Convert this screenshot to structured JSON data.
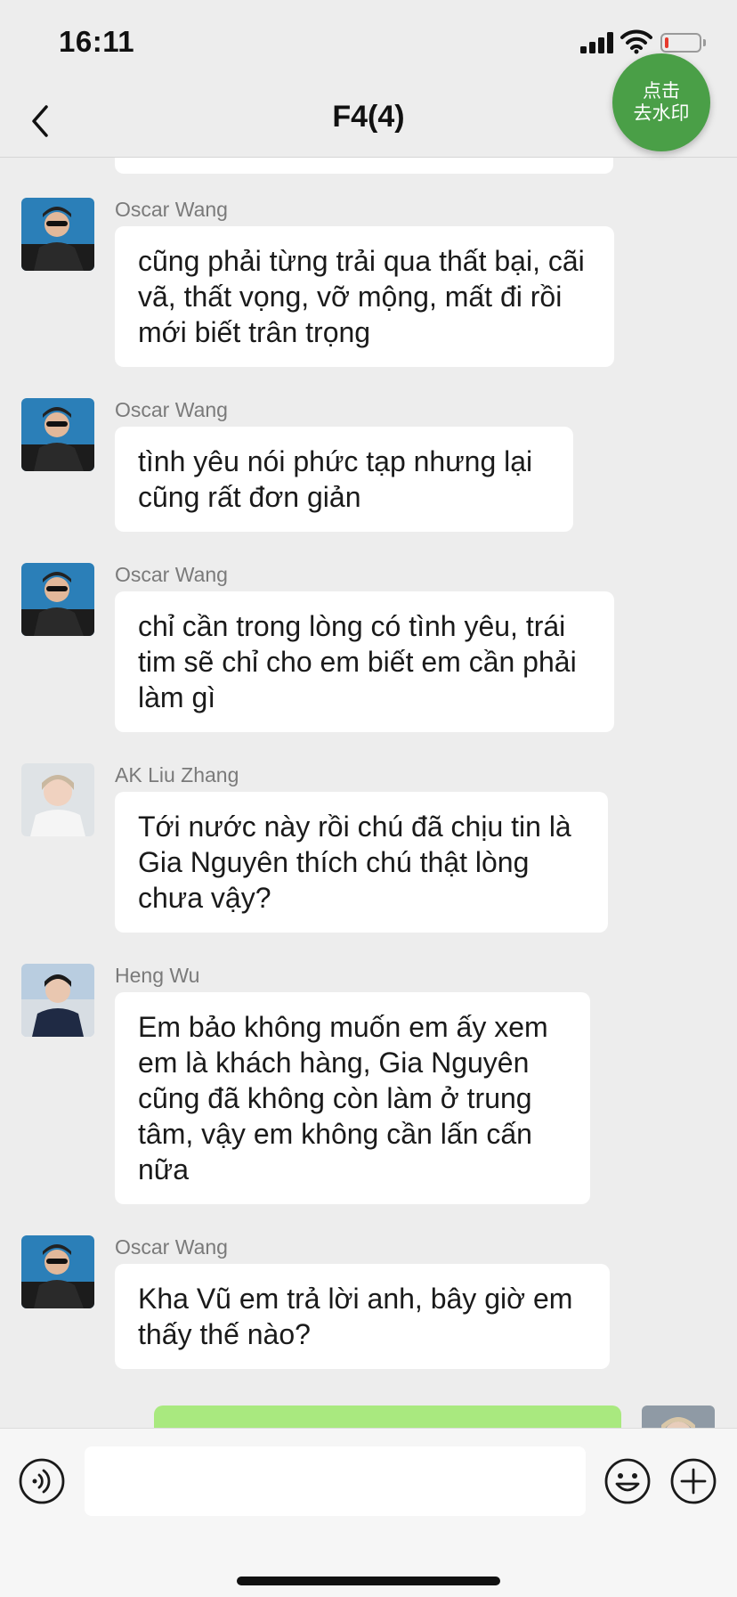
{
  "status_bar": {
    "time": "16:11"
  },
  "nav": {
    "title": "F4(4)",
    "back_icon": "chevron-left-icon"
  },
  "watermark_button": {
    "line1": "点击",
    "line2": "去水印"
  },
  "messages": [
    {
      "sender": "Oscar Wang",
      "text": "cũng phải từng trải qua thất bại, cãi vã, thất vọng, vỡ mộng, mất đi rồi mới biết trân trọng"
    },
    {
      "sender": "Oscar Wang",
      "text": "tình yêu nói phức tạp nhưng lại cũng rất đơn giản"
    },
    {
      "sender": "Oscar Wang",
      "text": "chỉ cần trong lòng có tình yêu, trái tim sẽ chỉ cho em biết em cần phải làm gì"
    },
    {
      "sender": "AK Liu Zhang",
      "text": "Tới nước này rồi chú đã chịu tin là Gia Nguyên thích chú thật lòng chưa vậy?"
    },
    {
      "sender": "Heng Wu",
      "text": "Em bảo không muốn em ấy xem em là khách hàng, Gia Nguyên cũng đã không còn làm ở trung tâm, vậy em không cần lấn cấn nữa"
    },
    {
      "sender": "Oscar Wang",
      "text": "Kha Vũ em trả lời anh, bây giờ em thấy thế nào?"
    }
  ],
  "colors": {
    "background": "#ededed",
    "bubble_in": "#ffffff",
    "bubble_out": "#a9e97f",
    "watermark_button": "#4a9f47"
  },
  "input_bar": {
    "voice_icon": "voice-icon",
    "emoji_icon": "emoji-icon",
    "plus_icon": "plus-icon",
    "placeholder": ""
  }
}
